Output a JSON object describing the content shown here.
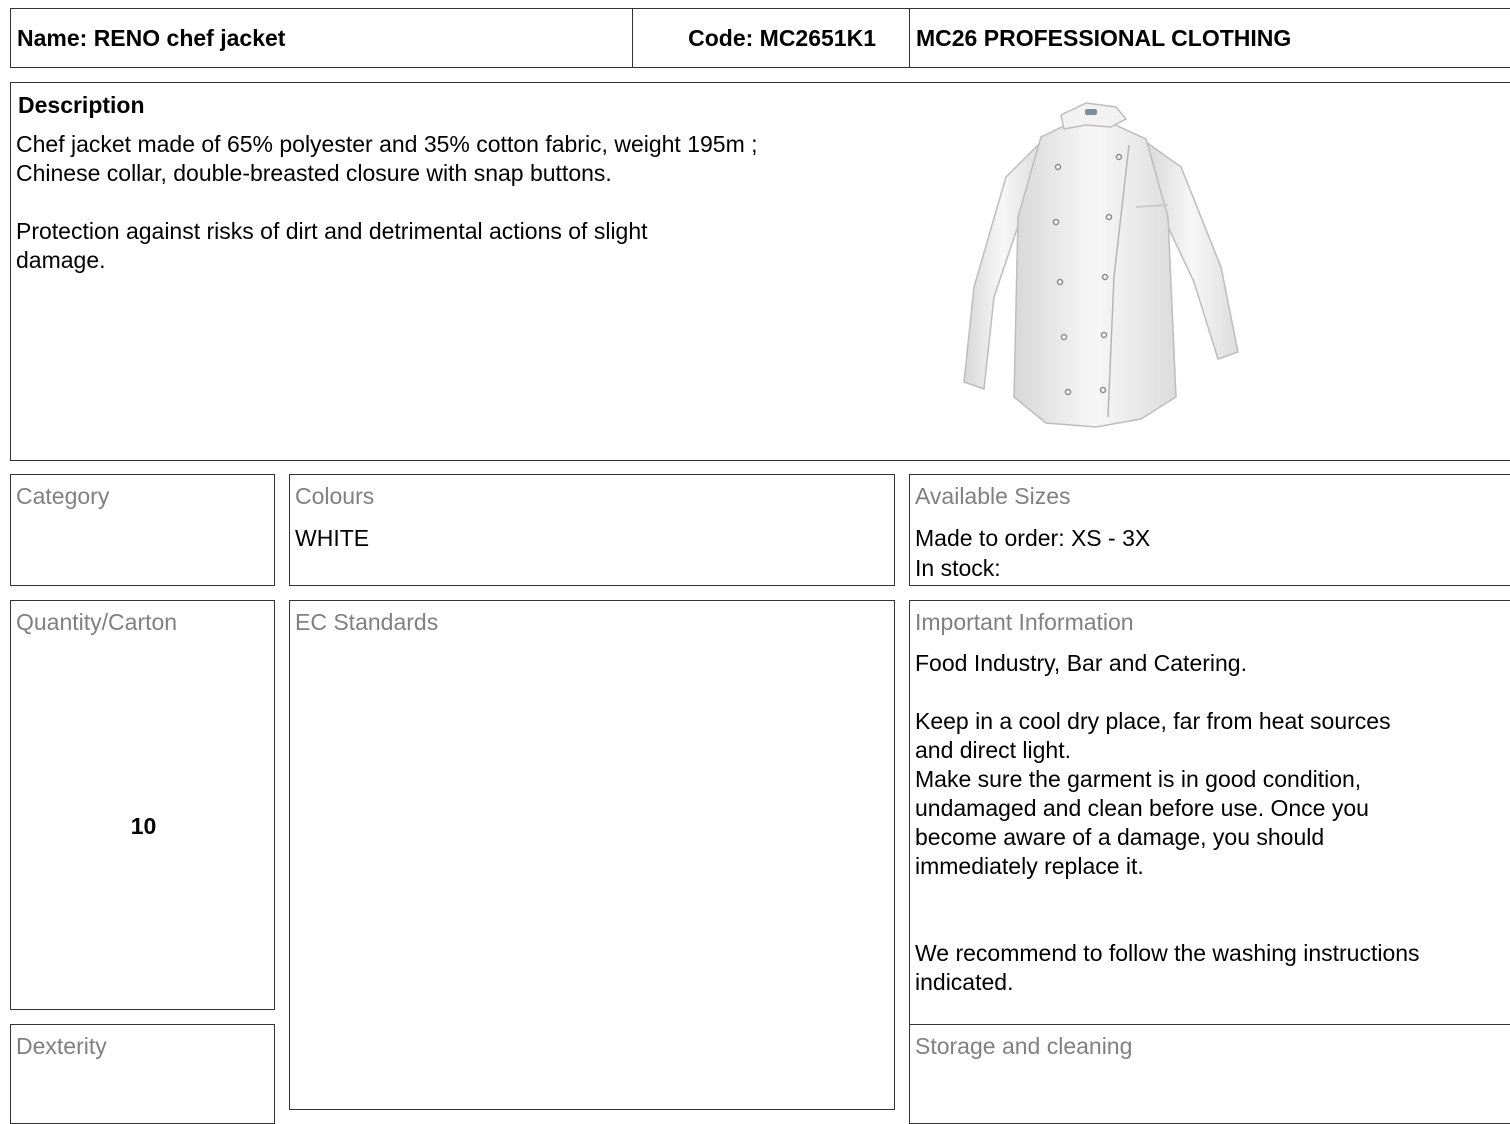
{
  "header": {
    "name": "Name: RENO chef jacket",
    "code": "Code: MC2651K1",
    "brand": "MC26 PROFESSIONAL CLOTHING"
  },
  "description": {
    "title": "Description",
    "text": "Chef jacket made of 65% polyester and 35% cotton fabric, weight 195m ;\nChinese collar, double-breasted closure with snap buttons.\n\nProtection against risks of dirt and detrimental actions of slight\ndamage."
  },
  "category": {
    "label": "Category",
    "value": ""
  },
  "colours": {
    "label": "Colours",
    "value": "WHITE"
  },
  "sizes": {
    "label": "Available Sizes",
    "value": "Made to order: XS - 3X\nIn stock:"
  },
  "quantity": {
    "label": "Quantity/Carton",
    "value": "10"
  },
  "standards": {
    "label": "EC Standards",
    "value": ""
  },
  "important": {
    "label": "Important Information",
    "value": "Food Industry, Bar and Catering.\n\nKeep in a cool dry place, far from heat sources\nand direct light.\nMake sure the garment is in good condition,\nundamaged and clean before use. Once you\nbecome aware of a damage, you should\nimmediately replace it.\n\n\nWe recommend to follow the washing instructions\nindicated."
  },
  "dexterity": {
    "label": "Dexterity",
    "value": ""
  },
  "storage": {
    "label": "Storage and cleaning",
    "value": ""
  }
}
